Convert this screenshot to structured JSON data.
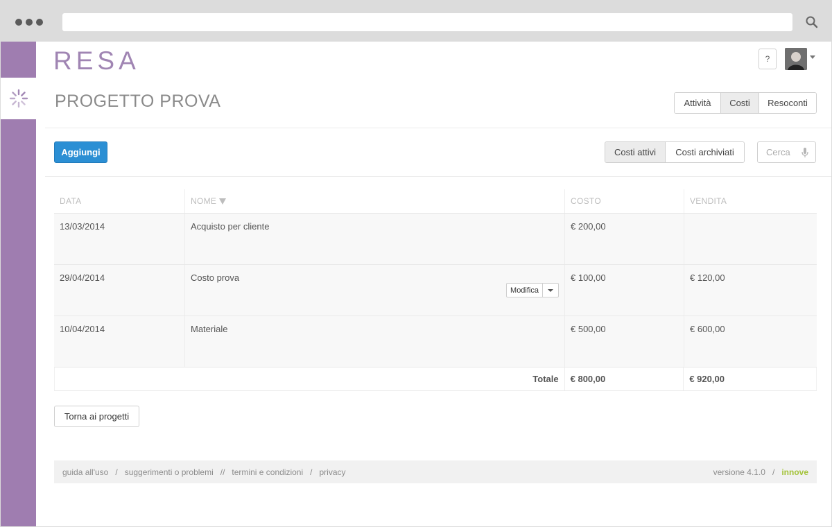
{
  "app": {
    "logo_text": "RESA",
    "help_label": "?",
    "project_title": "PROGETTO PROVA"
  },
  "tabs": [
    {
      "label": "Attività",
      "active": false
    },
    {
      "label": "Costi",
      "active": true
    },
    {
      "label": "Resoconti",
      "active": false
    }
  ],
  "toolbar": {
    "add_label": "Aggiungi",
    "filters": [
      {
        "label": "Costi attivi",
        "active": true
      },
      {
        "label": "Costi archiviati",
        "active": false
      }
    ],
    "search_placeholder": "Cerca"
  },
  "table": {
    "headers": {
      "date": "DATA",
      "name": "NOME",
      "cost": "COSTO",
      "sale": "VENDITA"
    },
    "rows": [
      {
        "date": "13/03/2014",
        "name": "Acquisto per cliente",
        "cost": "€ 200,00",
        "sale": ""
      },
      {
        "date": "29/04/2014",
        "name": "Costo prova",
        "cost": "€ 100,00",
        "sale": "€ 120,00",
        "action_label": "Modifica"
      },
      {
        "date": "10/04/2014",
        "name": "Materiale",
        "cost": "€ 500,00",
        "sale": "€ 600,00"
      }
    ],
    "total": {
      "label": "Totale",
      "cost": "€ 800,00",
      "sale": "€ 920,00"
    }
  },
  "back_label": "Torna ai progetti",
  "footer": {
    "links": [
      "guida all'uso",
      "suggerimenti o problemi",
      "termini e condizioni",
      "privacy"
    ],
    "separators": [
      "/",
      "//",
      "/"
    ],
    "version": "versione 4.1.0",
    "version_sep": "/",
    "brand": "innove"
  },
  "colors": {
    "sidebar": "#9f7db0",
    "primary": "#2b8fd4",
    "brand": "#a4c33a"
  }
}
